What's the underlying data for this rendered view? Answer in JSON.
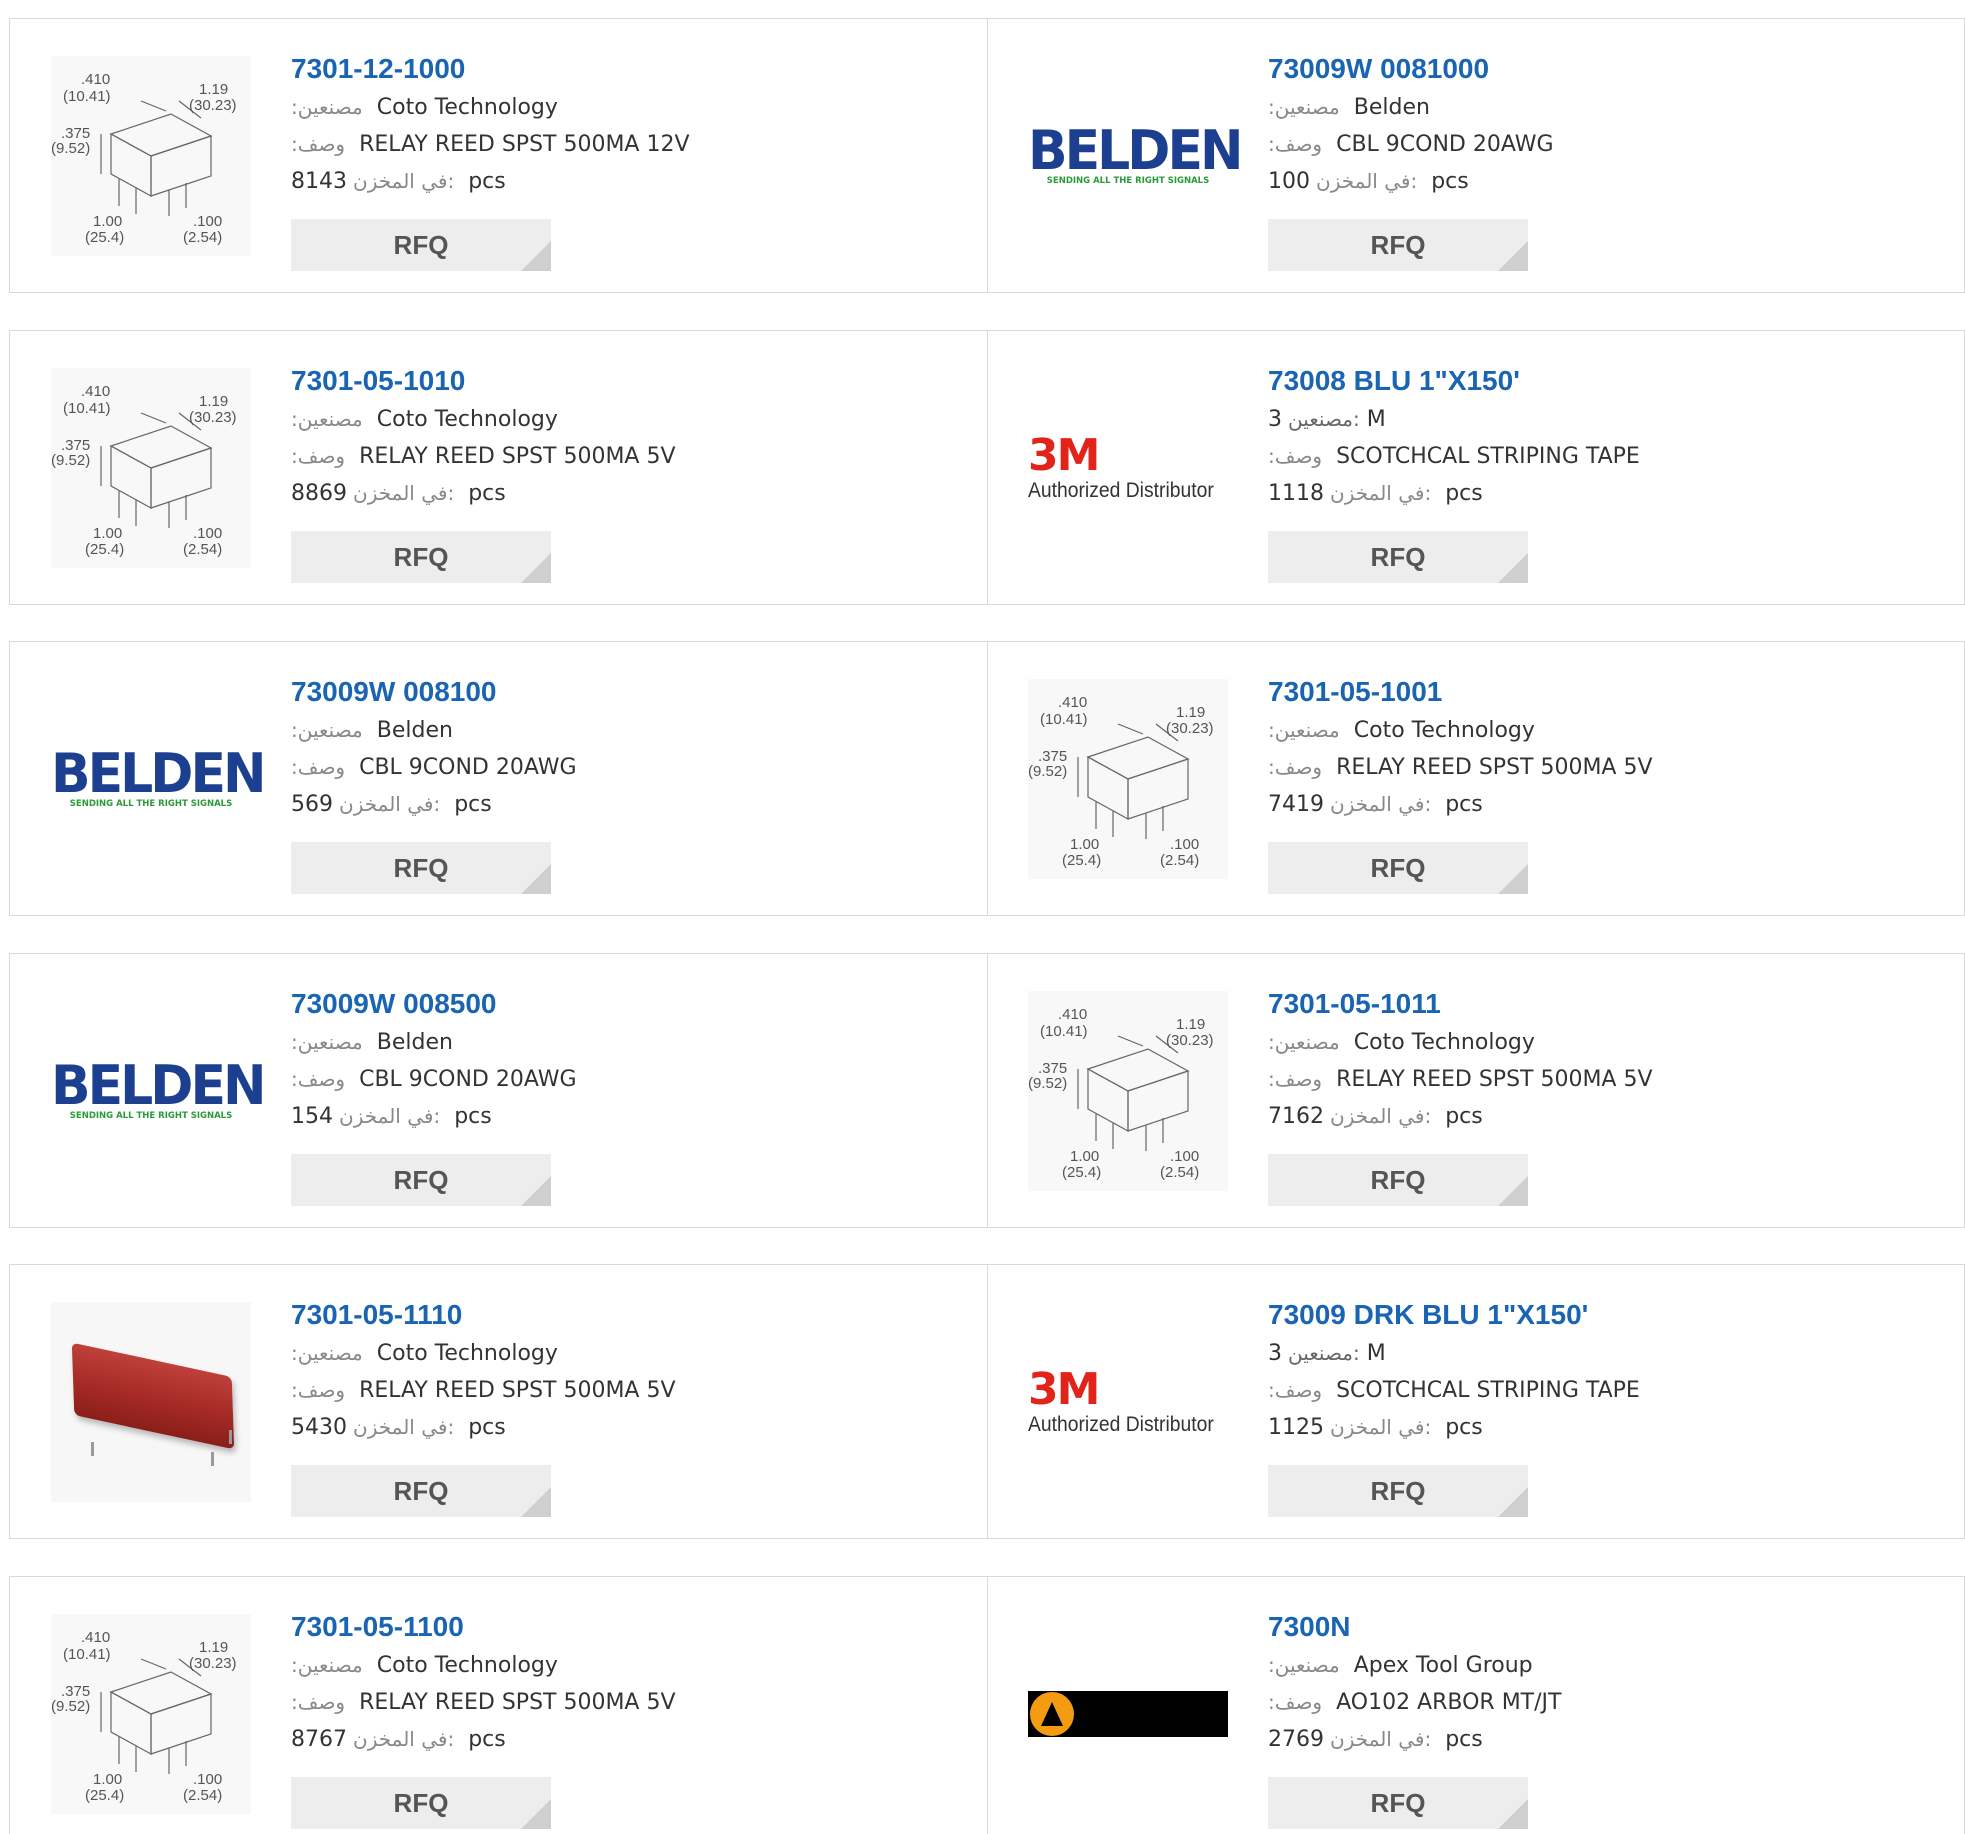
{
  "labels": {
    "manufacturer": ":مصنعين",
    "description": ":وصف",
    "stock": "في المخزن:",
    "unit": "pcs",
    "rfq": "RFQ"
  },
  "products": [
    {
      "part": "7301-12-1000",
      "manufacturer": "Coto Technology",
      "description": "RELAY REED SPST 500MA 12V",
      "stock": "8143",
      "logo": "relay-diagram-icon"
    },
    {
      "part": "73009W 0081000",
      "manufacturer": "Belden",
      "description": "CBL 9COND 20AWG",
      "stock": "100",
      "logo": "belden-logo"
    },
    {
      "part": "7301-05-1010",
      "manufacturer": "Coto Technology",
      "description": "RELAY REED SPST 500MA 5V",
      "stock": "8869",
      "logo": "relay-diagram-icon"
    },
    {
      "part": "73008 BLU 1\"X150'",
      "manufacturer_prefix": "M",
      "manufacturer_label": "مصنعين:",
      "manufacturer": "3",
      "description": "SCOTCHCAL STRIPING TAPE",
      "stock": "1118",
      "logo": "3m-logo"
    },
    {
      "part": "73009W 008100",
      "manufacturer": "Belden",
      "description": "CBL 9COND 20AWG",
      "stock": "569",
      "logo": "belden-logo"
    },
    {
      "part": "7301-05-1001",
      "manufacturer": "Coto Technology",
      "description": "RELAY REED SPST 500MA 5V",
      "stock": "7419",
      "logo": "relay-diagram-icon"
    },
    {
      "part": "73009W 008500",
      "manufacturer": "Belden",
      "description": "CBL 9COND 20AWG",
      "stock": "154",
      "logo": "belden-logo"
    },
    {
      "part": "7301-05-1011",
      "manufacturer": "Coto Technology",
      "description": "RELAY REED SPST 500MA 5V",
      "stock": "7162",
      "logo": "relay-diagram-icon"
    },
    {
      "part": "7301-05-1110",
      "manufacturer": "Coto Technology",
      "description": "RELAY REED SPST 500MA 5V",
      "stock": "5430",
      "logo": "red-relay-photo"
    },
    {
      "part": "73009 DRK BLU 1\"X150'",
      "manufacturer_prefix": "M",
      "manufacturer_label": "مصنعين:",
      "manufacturer": "3",
      "description": "SCOTCHCAL STRIPING TAPE",
      "stock": "1125",
      "logo": "3m-logo"
    },
    {
      "part": "7301-05-1100",
      "manufacturer": "Coto Technology",
      "description": "RELAY REED SPST 500MA 5V",
      "stock": "8767",
      "logo": "relay-diagram-icon"
    },
    {
      "part": "7300N",
      "manufacturer": "Apex Tool Group",
      "description": "AO102 ARBOR MT/JT",
      "stock": "2769",
      "logo": "apex-logo"
    }
  ],
  "logos": {
    "belden_word": "BELDEN",
    "belden_tag": "SENDING ALL THE RIGHT SIGNALS",
    "threem_mark": "3M",
    "threem_auth": "Authorized Distributor",
    "diagram": {
      "a": ".410",
      "a_mm": "(10.41)",
      "b": "1.19",
      "b_mm": "(30.23)",
      "c": ".375",
      "c_mm": "(9.52)",
      "d": "1.00",
      "d_mm": "(25.4)",
      "e": ".100",
      "e_mm": "(2.54)"
    }
  }
}
